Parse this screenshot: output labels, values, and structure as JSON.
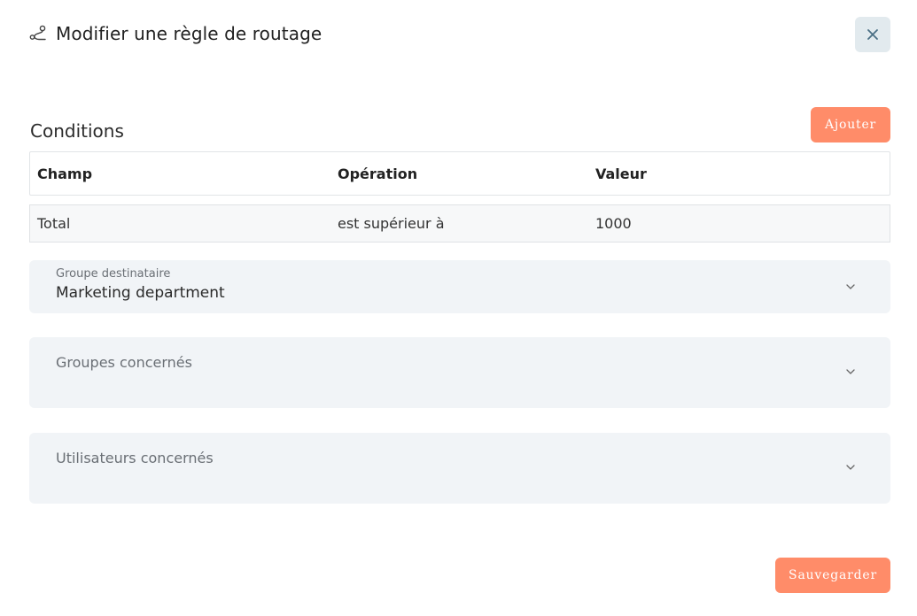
{
  "dialog": {
    "title": "Modifier une règle de routage",
    "icon": "route-icon",
    "close_icon": "close-icon"
  },
  "conditions": {
    "title": "Conditions",
    "add_label": "Ajouter",
    "columns": [
      "Champ",
      "Opération",
      "Valeur"
    ],
    "rows": [
      {
        "field": "Total",
        "operation": "est supérieur à",
        "value": "1000"
      }
    ]
  },
  "destination_group": {
    "label": "Groupe destinataire",
    "value": "Marketing department"
  },
  "groups": {
    "label": "Groupes concernés"
  },
  "users": {
    "label": "Utilisateurs concernés"
  },
  "footer": {
    "save_label": "Sauvegarder"
  },
  "colors": {
    "accent": "#ff8c69",
    "field_bg": "#f1f4f7",
    "close_bg": "#e2eaee"
  }
}
